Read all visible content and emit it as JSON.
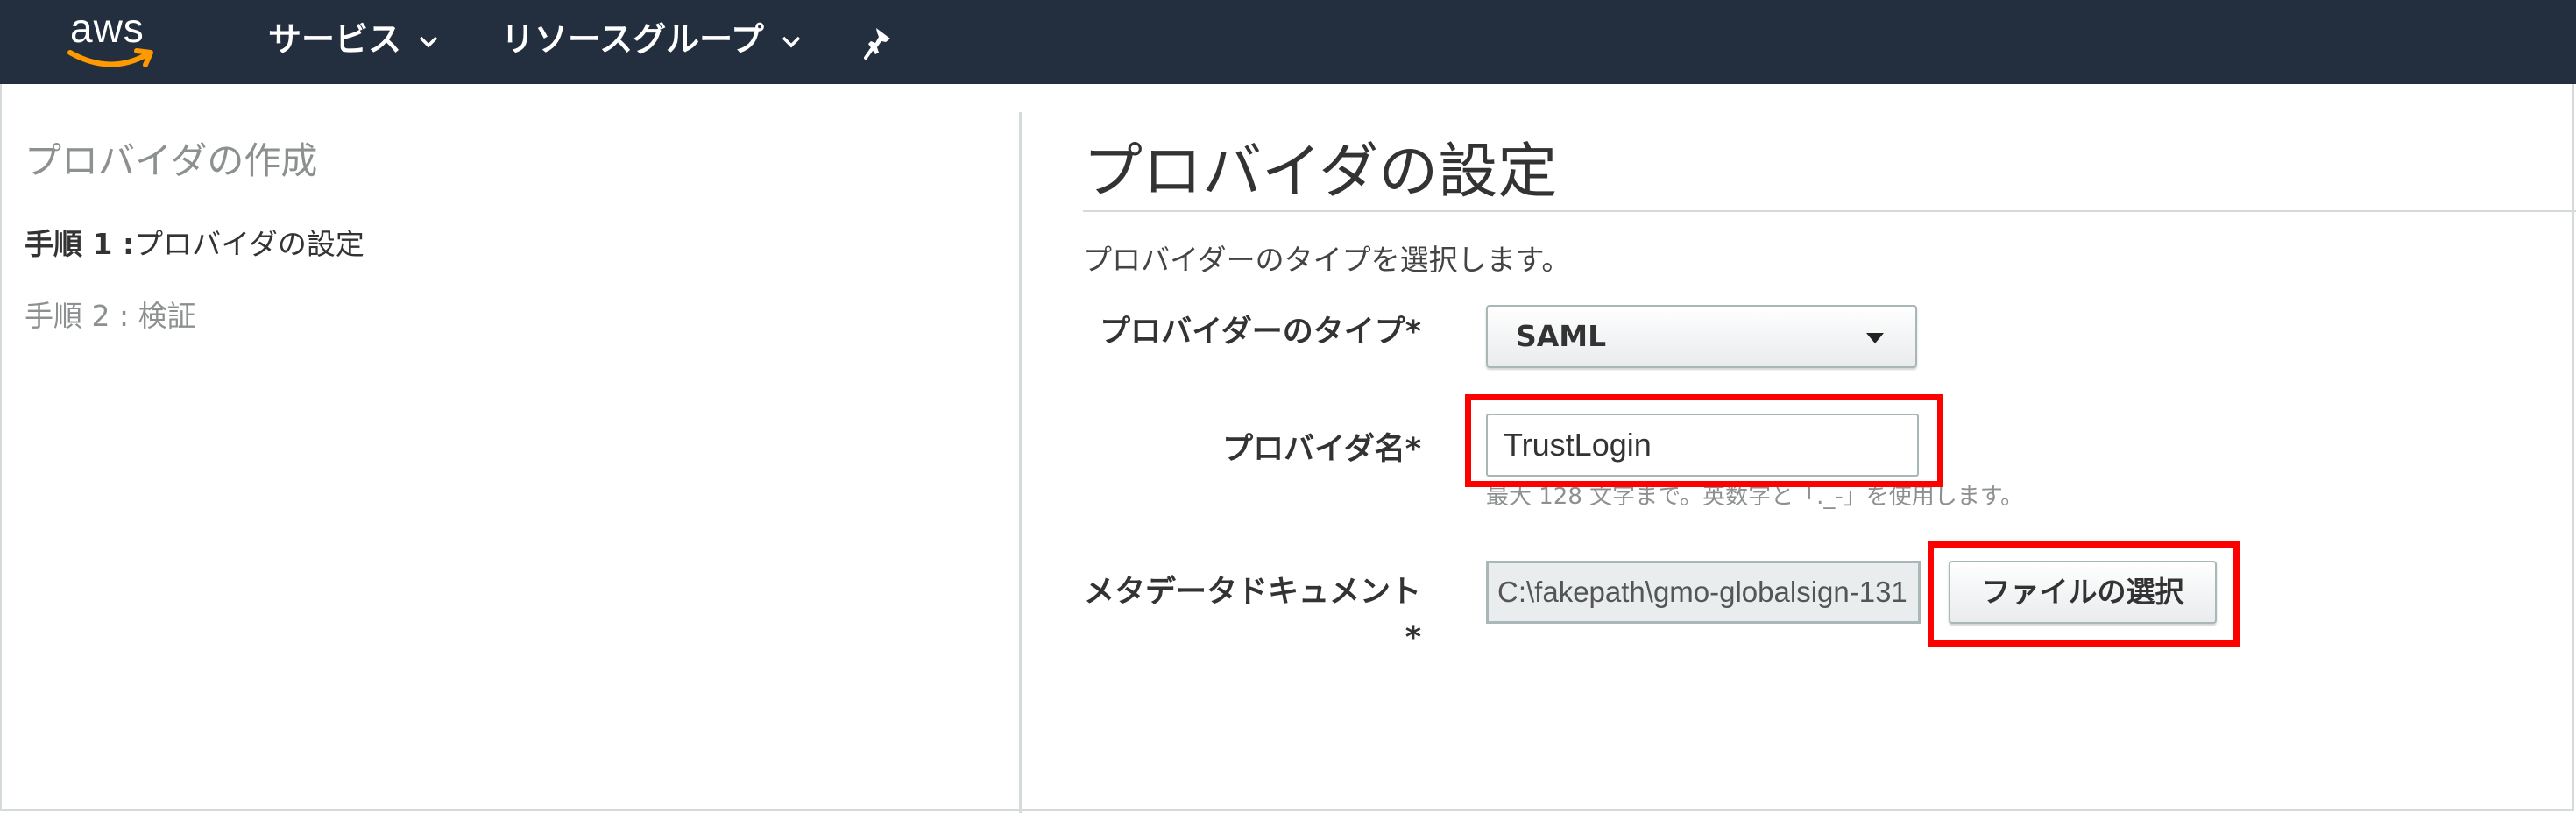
{
  "topbar": {
    "logo_text": "aws",
    "nav": [
      {
        "label": "サービス"
      },
      {
        "label": "リソースグループ"
      }
    ],
    "icons": [
      "chevron-down-icon",
      "pin-icon"
    ]
  },
  "sidebar": {
    "title": "プロバイダの作成",
    "step1": {
      "prefix": "手順 1 :",
      "label": "プロバイダの設定"
    },
    "step2": "手順 2 : 検証"
  },
  "main": {
    "title": "プロバイダの設定",
    "description": "プロバイダーのタイプを選択します。",
    "provider_type": {
      "label": "プロバイダーのタイプ*",
      "value": "SAML"
    },
    "provider_name": {
      "label": "プロバイダ名*",
      "value": "TrustLogin",
      "hint": "最大 128 文字まで。英数字と「._-」を使用します。"
    },
    "metadata": {
      "label_line1": "メタデータドキュメント",
      "label_line2": "*",
      "file_path": "C:\\fakepath\\gmo-globalsign-131",
      "button_label": "ファイルの選択"
    }
  },
  "colors": {
    "topbar_bg": "#232f3e",
    "highlight": "#ff0000",
    "logo_smile": "#ff9900"
  }
}
